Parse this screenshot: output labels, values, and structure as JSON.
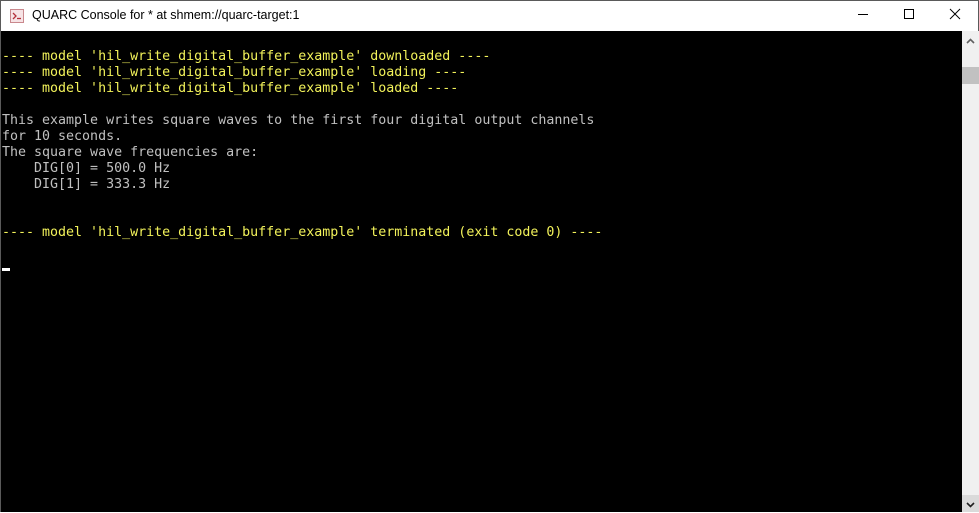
{
  "window": {
    "title": "QUARC Console for * at shmem://quarc-target:1",
    "icon": "console-icon",
    "controls": {
      "minimize": "minimize-icon",
      "maximize": "maximize-icon",
      "close": "close-icon"
    }
  },
  "console": {
    "colors": {
      "background": "#000000",
      "status_text": "#f2f25a",
      "info_text": "#c0c0c0",
      "cursor": "#ffffff"
    },
    "lines": [
      {
        "text": "",
        "style": "gray"
      },
      {
        "text": "---- model 'hil_write_digital_buffer_example' downloaded ----",
        "style": "yellow"
      },
      {
        "text": "---- model 'hil_write_digital_buffer_example' loading ----",
        "style": "yellow"
      },
      {
        "text": "---- model 'hil_write_digital_buffer_example' loaded ----",
        "style": "yellow"
      },
      {
        "text": "",
        "style": "gray"
      },
      {
        "text": "This example writes square waves to the first four digital output channels",
        "style": "gray"
      },
      {
        "text": "for 10 seconds.",
        "style": "gray"
      },
      {
        "text": "The square wave frequencies are:",
        "style": "gray"
      },
      {
        "text": "    DIG[0] = 500.0 Hz",
        "style": "gray"
      },
      {
        "text": "    DIG[1] = 333.3 Hz",
        "style": "gray"
      },
      {
        "text": "",
        "style": "gray"
      },
      {
        "text": "",
        "style": "gray"
      },
      {
        "text": "---- model 'hil_write_digital_buffer_example' terminated (exit code 0) ----",
        "style": "yellow"
      }
    ]
  },
  "scrollbar": {
    "up": "chevron-up-icon",
    "down": "chevron-down-icon"
  }
}
